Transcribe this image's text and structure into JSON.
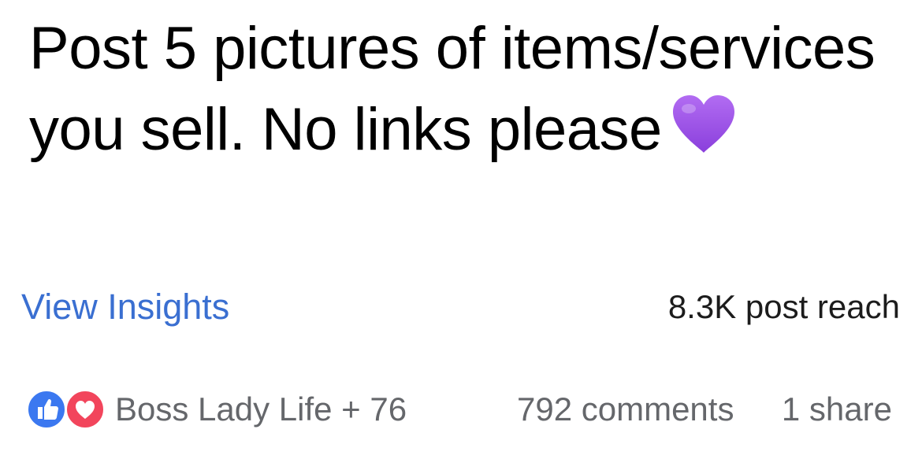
{
  "post": {
    "text": "Post 5 pictures of items/services you sell. No links please",
    "emoji": "purple-heart-icon"
  },
  "insights": {
    "link_label": "View Insights",
    "reach_label": "8.3K post reach"
  },
  "engagement": {
    "reaction_icons": [
      "like-icon",
      "love-icon"
    ],
    "reactors_label": "Boss Lady Life + 76",
    "comments_label": "792 comments",
    "shares_label": "1 share"
  },
  "colors": {
    "link": "#3a6fd1",
    "like": "#3b78f0",
    "love": "#f2455c",
    "heart": "#9b4de0",
    "muted": "#65676b"
  }
}
